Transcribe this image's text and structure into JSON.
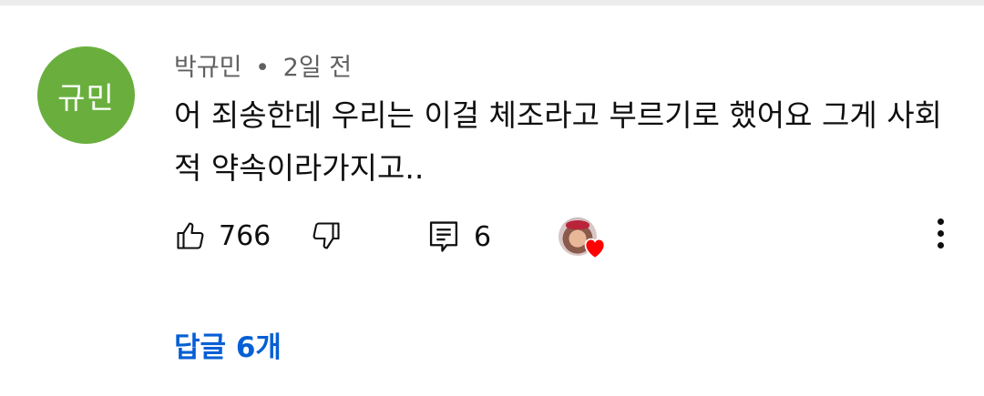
{
  "comment": {
    "avatar_text": "규민",
    "author": "박규민",
    "separator": "•",
    "time": "2일 전",
    "text": "어 죄송한데 우리는 이걸 체조라고 부르기로 했어요 그게 사회적 약속이라가지고..",
    "like_count": "766",
    "reply_count": "6",
    "replies_link": "답글 6개"
  },
  "colors": {
    "avatar_bg": "#6aaf3e",
    "link": "#065fd4",
    "heart": "#ff0000"
  },
  "icons": [
    "thumbs-up-icon",
    "thumbs-down-icon",
    "comment-icon",
    "heart-icon",
    "more-vert-icon"
  ]
}
